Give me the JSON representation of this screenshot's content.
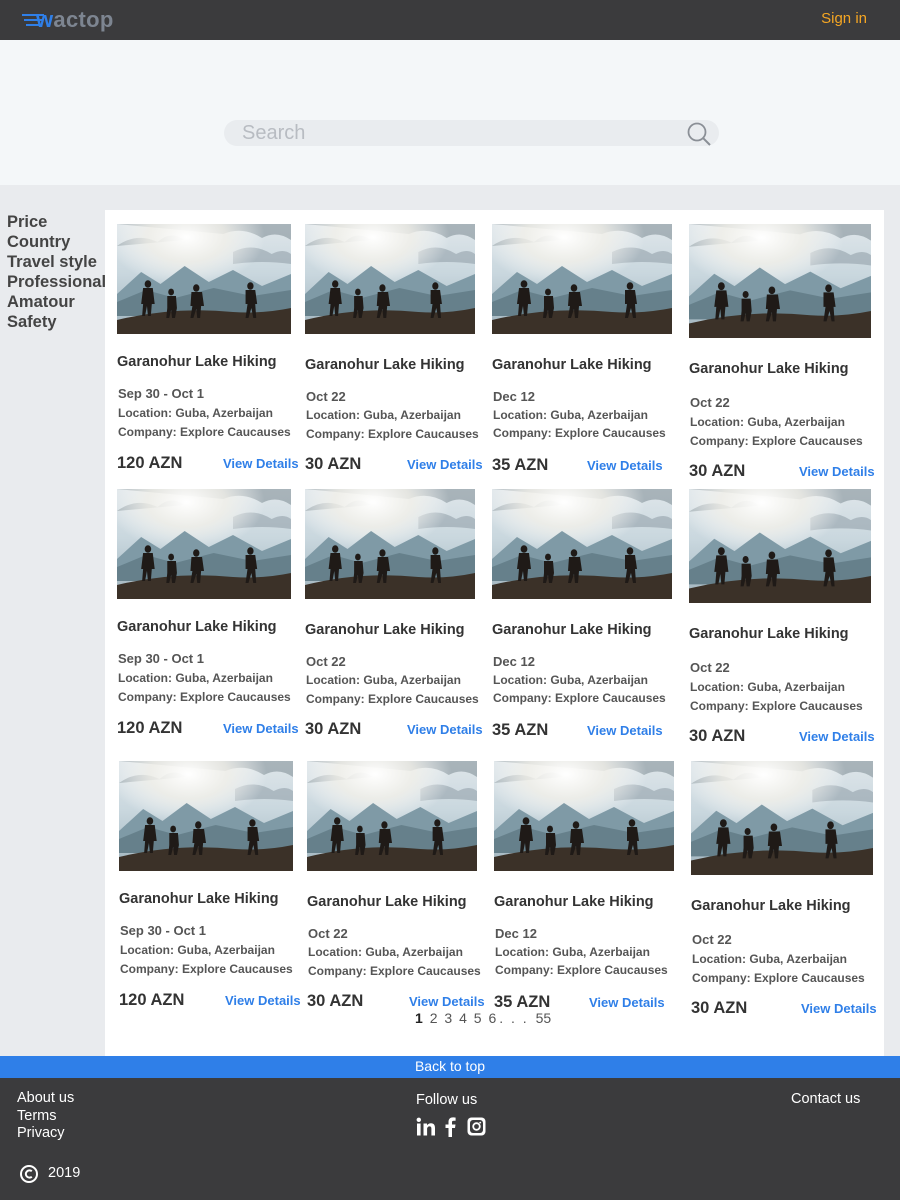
{
  "header": {
    "logo_prefix": "w",
    "logo_rest": "actop",
    "signin_label": "Sign in"
  },
  "search": {
    "placeholder": "Search"
  },
  "filters": [
    "Price",
    "Country",
    "Travel style",
    "Professional",
    "Amatour",
    "Safety"
  ],
  "tours": [
    {
      "title": "Garanohur Lake Hiking",
      "date": "Sep 30 - Oct 1",
      "location": "Location: Guba, Azerbaijan",
      "company": "Company: Explore Caucauses",
      "price": "120 AZN",
      "details": "View Details"
    },
    {
      "title": "Garanohur Lake Hiking",
      "date": "Oct 22",
      "location": "Location: Guba, Azerbaijan",
      "company": "Company: Explore Caucauses",
      "price": "30 AZN",
      "details": "View Details"
    },
    {
      "title": "Garanohur Lake Hiking",
      "date": "Dec 12",
      "location": "Location: Guba, Azerbaijan",
      "company": "Company: Explore Caucauses",
      "price": "35 AZN",
      "details": "View Details"
    },
    {
      "title": "Garanohur Lake Hiking",
      "date": "Oct 22",
      "location": "Location: Guba, Azerbaijan",
      "company": "Company: Explore Caucauses",
      "price": "30 AZN",
      "details": "View Details"
    },
    {
      "title": "Garanohur Lake Hiking",
      "date": "Sep 30 - Oct 1",
      "location": "Location: Guba, Azerbaijan",
      "company": "Company: Explore Caucauses",
      "price": "120 AZN",
      "details": "View Details"
    },
    {
      "title": "Garanohur Lake Hiking",
      "date": "Oct 22",
      "location": "Location: Guba, Azerbaijan",
      "company": "Company: Explore Caucauses",
      "price": "30 AZN",
      "details": "View Details"
    },
    {
      "title": "Garanohur Lake Hiking",
      "date": "Dec 12",
      "location": "Location: Guba, Azerbaijan",
      "company": "Company: Explore Caucauses",
      "price": "35 AZN",
      "details": "View Details"
    },
    {
      "title": "Garanohur Lake Hiking",
      "date": "Oct 22",
      "location": "Location: Guba, Azerbaijan",
      "company": "Company: Explore Caucauses",
      "price": "30 AZN",
      "details": "View Details"
    },
    {
      "title": "Garanohur Lake Hiking",
      "date": "Sep 30 - Oct 1",
      "location": "Location: Guba, Azerbaijan",
      "company": "Company: Explore Caucauses",
      "price": "120 AZN",
      "details": "View Details"
    },
    {
      "title": "Garanohur Lake Hiking",
      "date": "Oct 22",
      "location": "Location: Guba, Azerbaijan",
      "company": "Company: Explore Caucauses",
      "price": "30 AZN",
      "details": "View Details"
    },
    {
      "title": "Garanohur Lake Hiking",
      "date": "Dec 12",
      "location": "Location: Guba, Azerbaijan",
      "company": "Company: Explore Caucauses",
      "price": "35 AZN",
      "details": "View Details"
    },
    {
      "title": "Garanohur Lake Hiking",
      "date": "Oct 22",
      "location": "Location: Guba, Azerbaijan",
      "company": "Company: Explore Caucauses",
      "price": "30 AZN",
      "details": "View Details"
    }
  ],
  "pagination": {
    "current": "1",
    "pages": [
      "2",
      "3",
      "4",
      "5",
      "6"
    ],
    "ellipsis": ". . .",
    "last": "55"
  },
  "back_to_top": "Back to top",
  "footer": {
    "links": [
      "About us",
      "Terms",
      "Privacy"
    ],
    "follow_label": "Follow us",
    "social_icons": [
      "linkedin-icon",
      "facebook-icon",
      "instagram-icon"
    ],
    "contact_label": "Contact us",
    "year": "2019"
  },
  "colors": {
    "header_bg": "#3b3b3d",
    "accent_blue": "#2f7fe8",
    "signin_orange": "#f5a623"
  }
}
